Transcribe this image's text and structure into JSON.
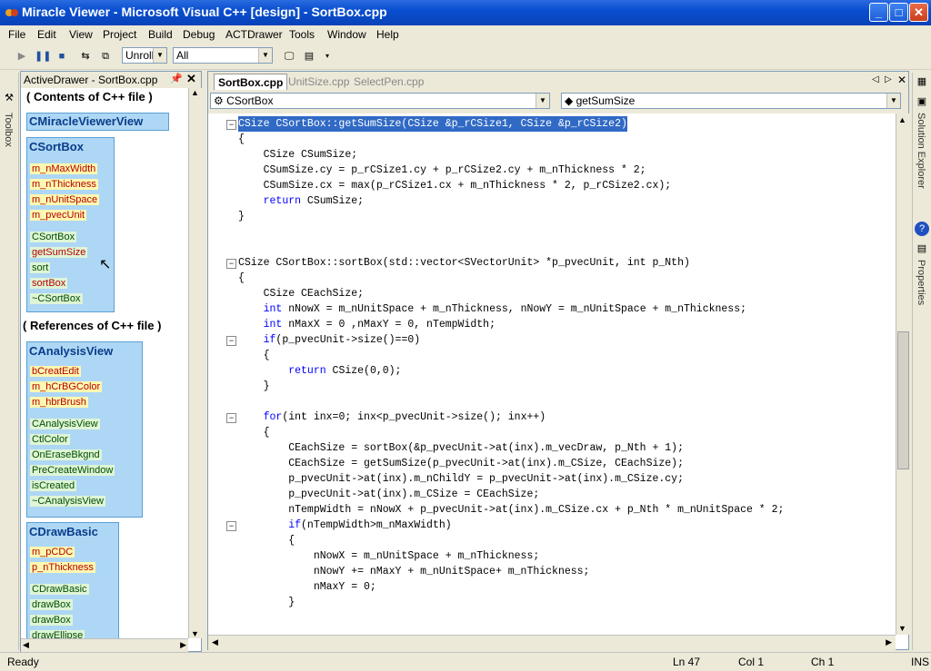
{
  "window": {
    "title": "Miracle Viewer - Microsoft Visual C++ [design] - SortBox.cpp",
    "min": "_",
    "max": "□",
    "close": "✕"
  },
  "menu": [
    "File",
    "Edit",
    "View",
    "Project",
    "Build",
    "Debug",
    "ACTDrawer",
    "Tools",
    "Window",
    "Help"
  ],
  "toolbar": {
    "unroll": "Unroll",
    "filter": "All"
  },
  "left_tab": {
    "toolbox": "Toolbox"
  },
  "active_drawer": {
    "title": "ActiveDrawer - SortBox.cpp",
    "contents_heading": "( Contents of C++ file )",
    "references_heading": "( References of C++ file )",
    "view_class": "CMiracleViewerView",
    "sortbox": {
      "title": "CSortBox",
      "members": [
        "m_nMaxWidth",
        "m_nThickness",
        "m_nUnitSpace",
        "m_pvecUnit"
      ],
      "methods": [
        "CSortBox",
        "getSumSize",
        "sort",
        "sortBox",
        "~CSortBox"
      ]
    },
    "analysis": {
      "title": "CAnalysisView",
      "members": [
        "bCreatEdit",
        "m_hCrBGColor",
        "m_hbrBrush"
      ],
      "methods": [
        "CAnalysisView",
        "CtlColor",
        "OnEraseBkgnd",
        "PreCreateWindow",
        "isCreated",
        "~CAnalysisView"
      ]
    },
    "drawbasic": {
      "title": "CDrawBasic",
      "members": [
        "m_pCDC",
        "p_nThickness"
      ],
      "methods": [
        "CDrawBasic",
        "drawBox",
        "drawBox",
        "drawEllipse"
      ]
    }
  },
  "editor": {
    "tabs": [
      "SortBox.cpp",
      "UnitSize.cpp",
      "SelectPen.cpp"
    ],
    "class_combo": "CSortBox",
    "member_combo": "getSumSize",
    "lines": [
      "CSize CSortBox::getSumSize(CSize &p_rCSize1, CSize &p_rCSize2)",
      "{",
      "    CSize CSumSize;",
      "    CSumSize.cy = p_rCSize1.cy + p_rCSize2.cy + m_nThickness * 2;",
      "    CSumSize.cx = max(p_rCSize1.cx + m_nThickness * 2, p_rCSize2.cx);",
      "    return CSumSize;",
      "}",
      "",
      "",
      "CSize CSortBox::sortBox(std::vector<SVectorUnit> *p_pvecUnit, int p_Nth)",
      "{",
      "    CSize CEachSize;",
      "    int nNowX = m_nUnitSpace + m_nThickness, nNowY = m_nUnitSpace + m_nThickness;",
      "    int nMaxX = 0 ,nMaxY = 0, nTempWidth;",
      "    if(p_pvecUnit->size()==0)",
      "    {",
      "        return CSize(0,0);",
      "    }",
      "",
      "    for(int inx=0; inx<p_pvecUnit->size(); inx++)",
      "    {",
      "        CEachSize = sortBox(&p_pvecUnit->at(inx).m_vecDraw, p_Nth + 1);",
      "        CEachSize = getSumSize(p_pvecUnit->at(inx).m_CSize, CEachSize);",
      "        p_pvecUnit->at(inx).m_nChildY = p_pvecUnit->at(inx).m_CSize.cy;",
      "        p_pvecUnit->at(inx).m_CSize = CEachSize;",
      "        nTempWidth = nNowX + p_pvecUnit->at(inx).m_CSize.cx + p_Nth * m_nUnitSpace * 2;",
      "        if(nTempWidth>m_nMaxWidth)",
      "        {",
      "            nNowX = m_nUnitSpace + m_nThickness;",
      "            nNowY += nMaxY + m_nUnitSpace+ m_nThickness;",
      "            nMaxY = 0;",
      "        }"
    ]
  },
  "right_tabs": {
    "solution": "Solution Explorer",
    "properties": "Properties"
  },
  "status": {
    "ready": "Ready",
    "line": "Ln 47",
    "col": "Col 1",
    "ch": "Ch 1",
    "ins": "INS"
  }
}
